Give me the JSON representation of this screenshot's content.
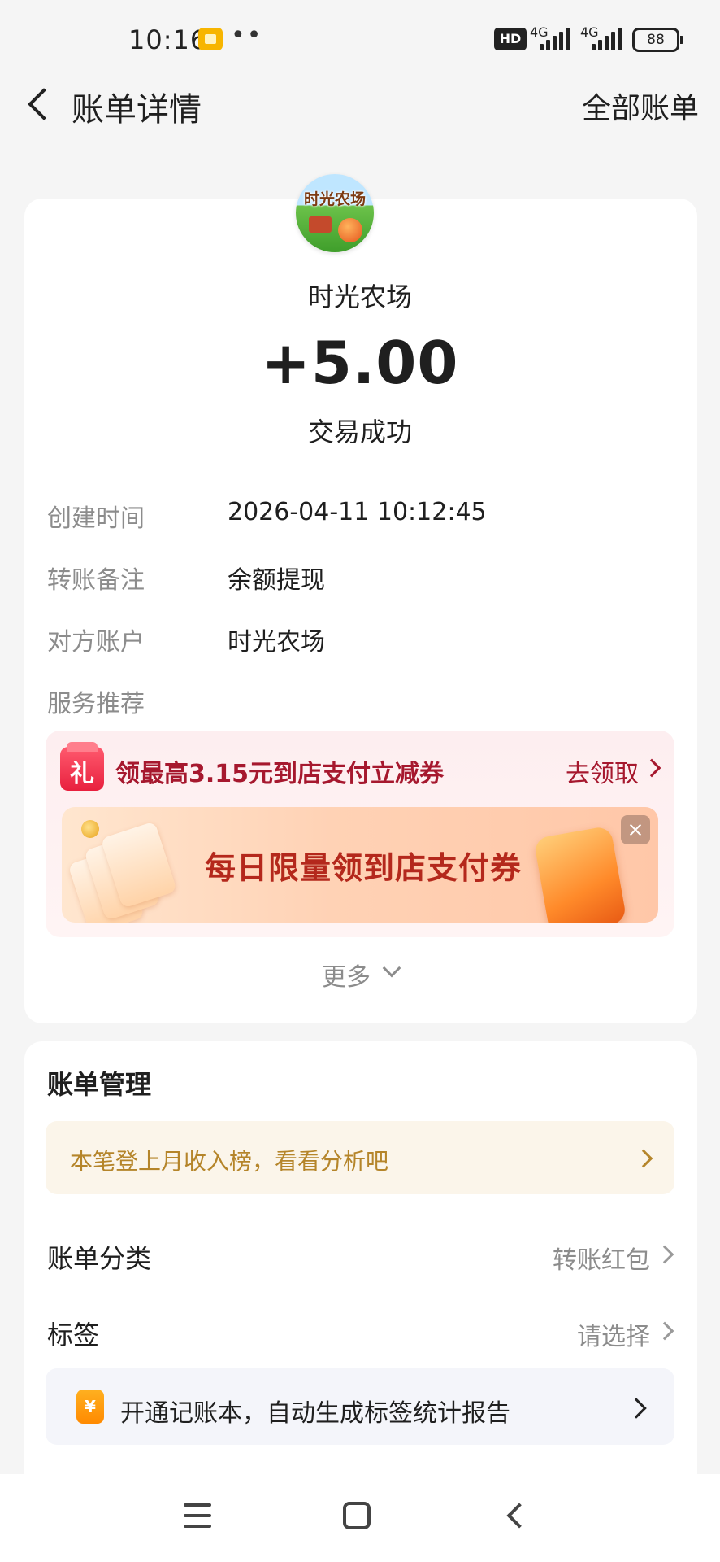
{
  "status_bar": {
    "time": "10:16",
    "dots": "••",
    "hd": "HD",
    "net1": "4G",
    "net2": "4G",
    "battery": "88"
  },
  "nav": {
    "title": "账单详情",
    "all_bills": "全部账单"
  },
  "merchant": {
    "logo_text": "时光农场",
    "name": "时光农场",
    "amount": "+5.00",
    "status": "交易成功"
  },
  "details": [
    {
      "label": "创建时间",
      "value": "2026-04-11 10:12:45"
    },
    {
      "label": "转账备注",
      "value": "余额提现"
    },
    {
      "label": "对方账户",
      "value": "时光农场"
    },
    {
      "label": "服务推荐",
      "value": ""
    }
  ],
  "promo": {
    "gift_char": "礼",
    "title": "领最高3.15元到店支付立减券",
    "action": "去领取",
    "banner_text": "每日限量领到店支付券"
  },
  "more": "更多",
  "manage": {
    "title": "账单管理",
    "analysis": "本笔登上月收入榜，看看分析吧",
    "category_label": "账单分类",
    "category_value": "转账红包",
    "tag_label": "标签",
    "tag_value": "请选择",
    "ledger_icon": "¥",
    "ledger_text": "开通记账本，自动生成标签统计报告"
  },
  "colors": {
    "accent_red": "#a6182e",
    "gold_text": "#b5852a",
    "muted": "#8c8c8c"
  }
}
